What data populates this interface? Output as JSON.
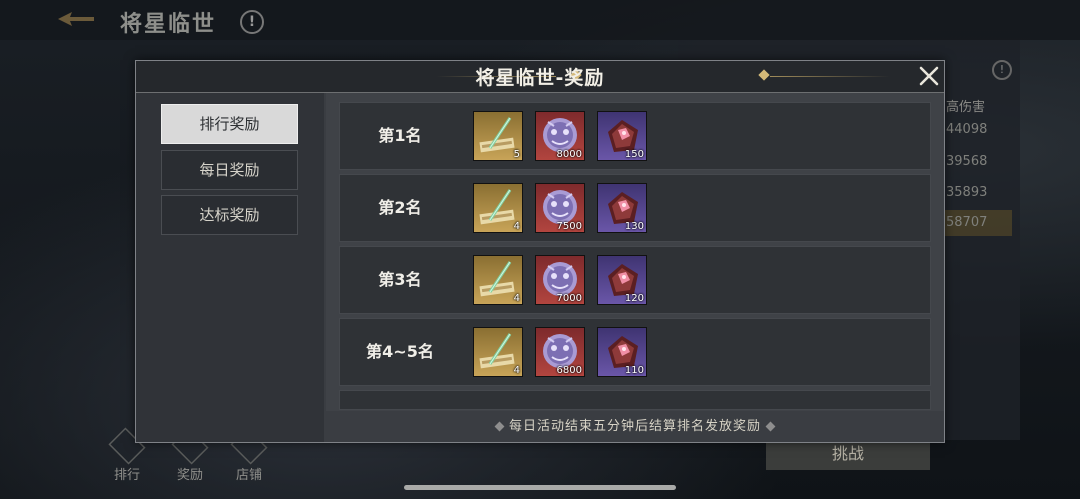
{
  "background": {
    "title": "将星临世",
    "info_icon": "!",
    "right_panel": {
      "header": "高伤害",
      "values": [
        "44098",
        "39568",
        "35893",
        "58707"
      ]
    },
    "challenge_button": "挑战",
    "bottom_nav": [
      {
        "label": "排行",
        "icon": "ranking-icon"
      },
      {
        "label": "奖励",
        "icon": "reward-icon"
      },
      {
        "label": "店铺",
        "icon": "shop-icon"
      }
    ]
  },
  "dialog": {
    "title": "将星临世-奖励",
    "tabs": [
      {
        "label": "排行奖励",
        "active": true
      },
      {
        "label": "每日奖励",
        "active": false
      },
      {
        "label": "达标奖励",
        "active": false
      }
    ],
    "rows": [
      {
        "rank": "第1名",
        "items": [
          {
            "type": "scroll",
            "quality": "gold",
            "count": "5"
          },
          {
            "type": "tiger-badge",
            "quality": "red",
            "count": "8000"
          },
          {
            "type": "gem",
            "quality": "purple",
            "count": "150"
          }
        ]
      },
      {
        "rank": "第2名",
        "items": [
          {
            "type": "scroll",
            "quality": "gold",
            "count": "4"
          },
          {
            "type": "tiger-badge",
            "quality": "red",
            "count": "7500"
          },
          {
            "type": "gem",
            "quality": "purple",
            "count": "130"
          }
        ]
      },
      {
        "rank": "第3名",
        "items": [
          {
            "type": "scroll",
            "quality": "gold",
            "count": "4"
          },
          {
            "type": "tiger-badge",
            "quality": "red",
            "count": "7000"
          },
          {
            "type": "gem",
            "quality": "purple",
            "count": "120"
          }
        ]
      },
      {
        "rank": "第4~5名",
        "items": [
          {
            "type": "scroll",
            "quality": "gold",
            "count": "4"
          },
          {
            "type": "tiger-badge",
            "quality": "red",
            "count": "6800"
          },
          {
            "type": "gem",
            "quality": "purple",
            "count": "110"
          }
        ]
      }
    ],
    "footer_note": "每日活动结束五分钟后结算排名发放奖励"
  }
}
